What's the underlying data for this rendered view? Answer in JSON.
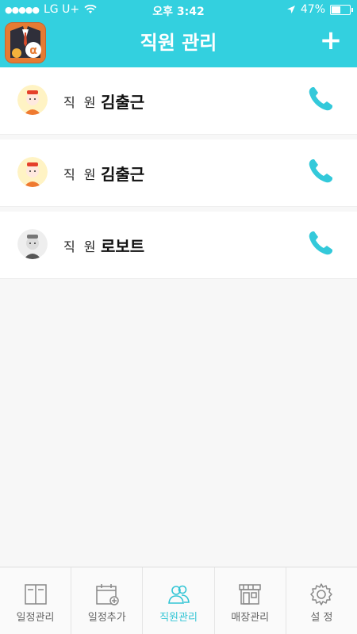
{
  "status": {
    "carrier": "LG U+",
    "time": "오후 3:42",
    "battery": "47%",
    "battery_level": 0.47
  },
  "header": {
    "title": "직원 관리",
    "add_label": "+"
  },
  "employees": [
    {
      "role": "직 원",
      "name": "김출근",
      "avatar": "chef-character-avatar"
    },
    {
      "role": "직 원",
      "name": "김출근",
      "avatar": "chef-character-avatar"
    },
    {
      "role": "직 원",
      "name": "로보트",
      "avatar": "robot-character-avatar"
    }
  ],
  "tabs": [
    {
      "label": "일정관리",
      "icon": "schedule-list-icon",
      "active": false
    },
    {
      "label": "일정추가",
      "icon": "calendar-add-icon",
      "active": false
    },
    {
      "label": "직원관리",
      "icon": "people-icon",
      "active": true
    },
    {
      "label": "매장관리",
      "icon": "store-icon",
      "active": false
    },
    {
      "label": "설 정",
      "icon": "gear-icon",
      "active": false
    }
  ],
  "colors": {
    "accent": "#33d0df",
    "active_tab": "#33c5d5"
  }
}
